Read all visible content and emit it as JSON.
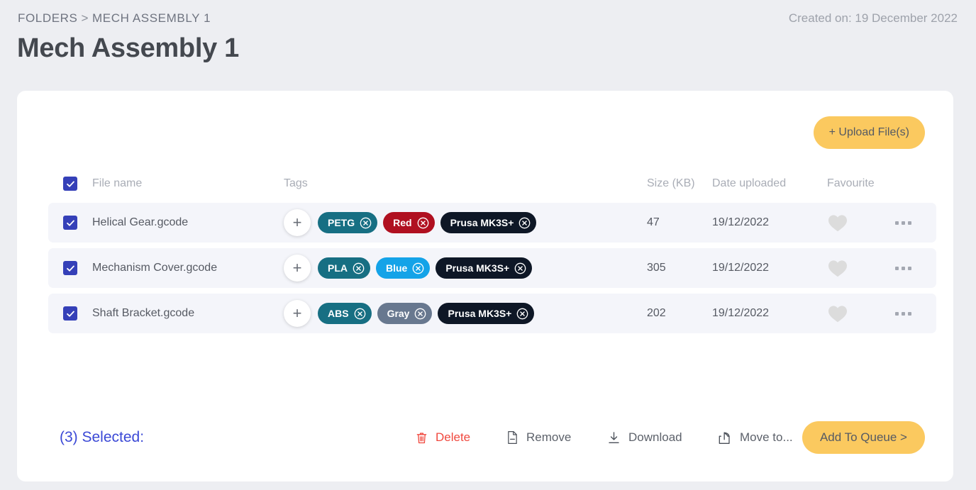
{
  "header": {
    "breadcrumb_root": "FOLDERS",
    "breadcrumb_separator": ">",
    "breadcrumb_current": "MECH ASSEMBLY 1",
    "title": "Mech Assembly 1",
    "created_on": "Created on: 19 December 2022"
  },
  "toolbar": {
    "upload_label": "+ Upload File(s)"
  },
  "table": {
    "columns": {
      "file_name": "File name",
      "tags": "Tags",
      "size": "Size (KB)",
      "date": "Date uploaded",
      "favourite": "Favourite"
    },
    "select_all_checked": true,
    "add_tag_label": "+",
    "rows": [
      {
        "checked": true,
        "file_name": "Helical Gear.gcode",
        "tags": [
          {
            "label": "PETG",
            "color": "#176f83"
          },
          {
            "label": "Red",
            "color": "#b01020"
          },
          {
            "label": "Prusa MK3S+",
            "color": "#0e1726"
          }
        ],
        "size": "47",
        "date": "19/12/2022",
        "favourite": false
      },
      {
        "checked": true,
        "file_name": "Mechanism Cover.gcode",
        "tags": [
          {
            "label": "PLA",
            "color": "#176f83"
          },
          {
            "label": "Blue",
            "color": "#14a3e8"
          },
          {
            "label": "Prusa MK3S+",
            "color": "#0e1726"
          }
        ],
        "size": "305",
        "date": "19/12/2022",
        "favourite": false
      },
      {
        "checked": true,
        "file_name": "Shaft Bracket.gcode",
        "tags": [
          {
            "label": "ABS",
            "color": "#176f83"
          },
          {
            "label": "Gray",
            "color": "#68788f"
          },
          {
            "label": "Prusa MK3S+",
            "color": "#0e1726"
          }
        ],
        "size": "202",
        "date": "19/12/2022",
        "favourite": false
      }
    ]
  },
  "actions": {
    "selected_label": "(3) Selected:",
    "delete_label": "Delete",
    "remove_label": "Remove",
    "download_label": "Download",
    "move_label": "Move to...",
    "queue_label": "Add To Queue >"
  },
  "colors": {
    "page_background": "#edeef2",
    "card_background": "#ffffff",
    "row_background": "#f4f5fa",
    "accent_yellow": "#fbc95f",
    "checkbox_blue": "#3540b8",
    "selected_text_blue": "#3b49d6",
    "delete_red": "#f0483e",
    "heart_gray": "#dcdcdc"
  }
}
